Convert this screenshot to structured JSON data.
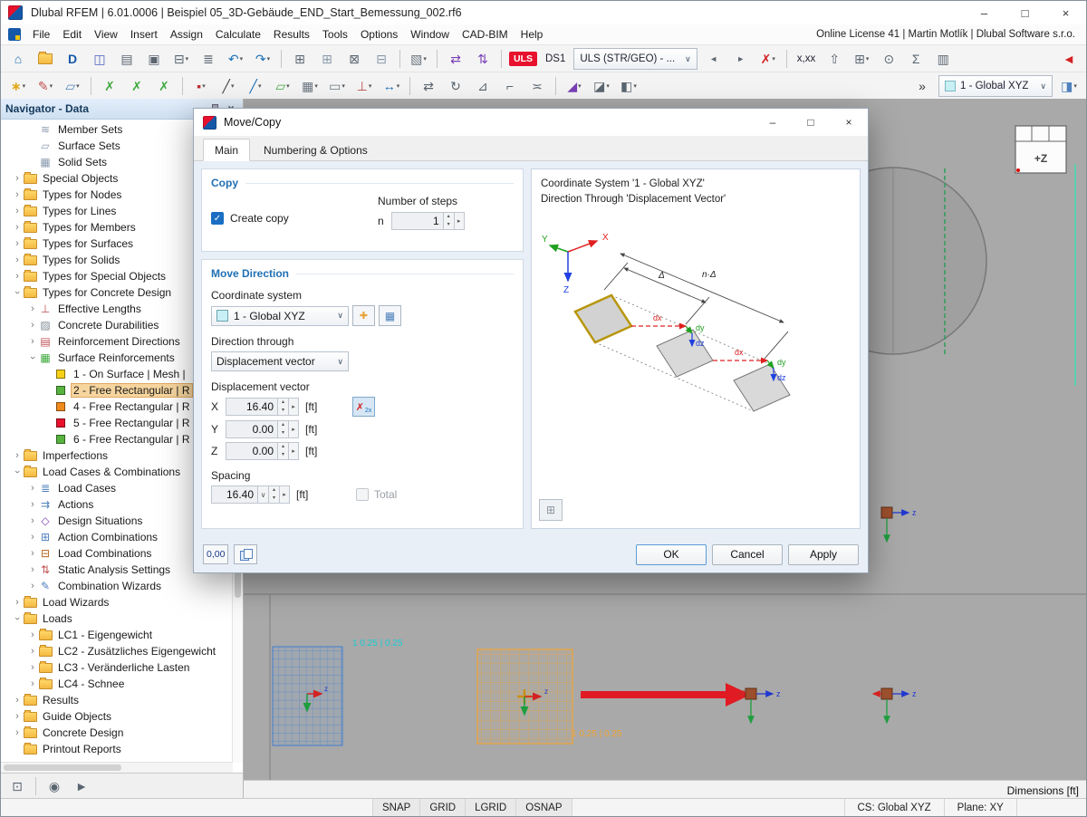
{
  "window": {
    "title": "Dlubal RFEM | 6.01.0006 | Beispiel 05_3D-Gebäude_END_Start_Bemessung_002.rf6",
    "minimize": "–",
    "maximize": "□",
    "close": "×"
  },
  "menu": {
    "items": [
      "File",
      "Edit",
      "View",
      "Insert",
      "Assign",
      "Calculate",
      "Results",
      "Tools",
      "Options",
      "Window",
      "CAD-BIM",
      "Help"
    ],
    "right_text": "Online License 41 | Martin Motlík | Dlubal Software s.r.o."
  },
  "toolbar_main": {
    "items": [
      {
        "name": "new-model-button",
        "glyph": "⌂",
        "color": "#1c6fb8"
      },
      {
        "name": "open-file-button",
        "folder": true
      },
      {
        "name": "dlubal-center-button",
        "glyph": "D",
        "color": "#1558a8",
        "bold": true
      },
      {
        "name": "bim-connect-button",
        "glyph": "◫",
        "color": "#4a5fc1"
      },
      {
        "name": "print-preview-button",
        "glyph": "▤",
        "color": "#5a6570"
      },
      {
        "name": "save-button",
        "glyph": "▣",
        "color": "#5a6570"
      },
      {
        "name": "print-button",
        "glyph": "⊟",
        "color": "#5a6570",
        "caret": true
      },
      {
        "name": "printout-report-button",
        "glyph": "≣",
        "color": "#5a6570"
      },
      {
        "name": "undo-button",
        "glyph": "↶",
        "color": "#1c6fb8",
        "caret": true
      },
      {
        "name": "redo-button",
        "glyph": "↷",
        "color": "#1c6fb8",
        "caret": true
      },
      {
        "sep": true
      },
      {
        "name": "new-table-button",
        "glyph": "⊞",
        "color": "#5a6570"
      },
      {
        "name": "tables-button",
        "glyph": "⊞",
        "color": "#8899aa"
      },
      {
        "name": "table-filter-button",
        "glyph": "⊠",
        "color": "#5a6570"
      },
      {
        "name": "table-relations-button",
        "glyph": "⊟",
        "color": "#8899aa"
      },
      {
        "sep": true
      },
      {
        "name": "rendering-button",
        "glyph": "▧",
        "color": "#6a7580",
        "caret": true
      },
      {
        "sep": true
      },
      {
        "name": "import-export-button",
        "glyph": "⇄",
        "color": "#7a3fb5"
      },
      {
        "name": "load-transfer-button",
        "glyph": "⇅",
        "color": "#7a3fb5"
      },
      {
        "sep": true
      },
      {
        "name": "uls-badge",
        "badge": "ULS",
        "bg": "#e8112d",
        "fg": "#ffffff"
      },
      {
        "name": "design-situation-label",
        "text": "DS1"
      },
      {
        "name": "design-situation-combo",
        "combo": "ULS (STR/GEO) - ..."
      },
      {
        "name": "previous-button",
        "glyph": "◄",
        "color": "#5a6570",
        "small": true
      },
      {
        "name": "next-button",
        "glyph": "►",
        "color": "#5a6570",
        "small": true
      },
      {
        "name": "delete-results-button",
        "glyph": "✗",
        "color": "#d42222",
        "caret": true
      },
      {
        "sep": true
      },
      {
        "name": "decimal-places-button",
        "text": "x,xx"
      },
      {
        "name": "user-view-button",
        "glyph": "⇧",
        "color": "#5a6570"
      },
      {
        "name": "result-tables-button",
        "glyph": "⊞",
        "color": "#5a6570",
        "caret": true
      },
      {
        "name": "search-button",
        "glyph": "⊙",
        "color": "#5a6570"
      },
      {
        "name": "sum-button",
        "glyph": "Σ",
        "color": "#5a6570"
      },
      {
        "name": "pages-button",
        "glyph": "▥",
        "color": "#5a6570"
      },
      {
        "name": "go-back-button",
        "glyph": "◄",
        "color": "#d42222",
        "bold": true,
        "gap": true
      }
    ]
  },
  "toolbar_edit": {
    "items": [
      {
        "name": "snap-settings-button",
        "glyph": "∗",
        "color": "#e0a818",
        "bold": true,
        "caret": true
      },
      {
        "name": "work-plane-button",
        "glyph": "✎",
        "color": "#c05050",
        "caret": true
      },
      {
        "name": "grid-settings-button",
        "glyph": "▱",
        "color": "#4f81bd",
        "caret": true
      },
      {
        "sep": true
      },
      {
        "name": "object-snap-toggle",
        "glyph": "✗",
        "color": "#3faa3f"
      },
      {
        "name": "grid-snap-toggle",
        "glyph": "✗",
        "color": "#3faa3f"
      },
      {
        "name": "guideline-snap-toggle",
        "glyph": "✗",
        "color": "#3faa3f"
      },
      {
        "sep": true
      },
      {
        "name": "insert-node-button",
        "glyph": "▪",
        "color": "#c03030",
        "caret": true
      },
      {
        "name": "insert-line-button",
        "glyph": "╱",
        "color": "#444444",
        "caret": true
      },
      {
        "name": "insert-member-button",
        "glyph": "╱",
        "color": "#1c6fb8",
        "caret": true
      },
      {
        "name": "insert-surface-button",
        "glyph": "▱",
        "color": "#3faa3f",
        "caret": true
      },
      {
        "name": "insert-solid-button",
        "glyph": "▦",
        "color": "#6a7580",
        "caret": true
      },
      {
        "name": "insert-opening-button",
        "glyph": "▭",
        "color": "#6a7580",
        "caret": true
      },
      {
        "name": "insert-support-button",
        "glyph": "⊥",
        "color": "#c05050",
        "caret": true
      },
      {
        "name": "insert-dimension-button",
        "glyph": "↔",
        "color": "#1c6fb8",
        "caret": true
      },
      {
        "sep": true
      },
      {
        "name": "move-copy-button",
        "glyph": "⇄",
        "color": "#5a6570"
      },
      {
        "name": "rotate-button",
        "glyph": "↻",
        "color": "#5a6570"
      },
      {
        "name": "mirror-button",
        "glyph": "⊿",
        "color": "#5a6570"
      },
      {
        "name": "trim-button",
        "glyph": "⌐",
        "color": "#5a6570"
      },
      {
        "name": "divide-button",
        "glyph": "≍",
        "color": "#5a6570"
      },
      {
        "sep": true
      },
      {
        "name": "section-button",
        "glyph": "◢",
        "color": "#7a3fb5",
        "caret": true
      },
      {
        "name": "visibility-button",
        "glyph": "◪",
        "color": "#5a6570",
        "caret": true
      },
      {
        "name": "clipping-button",
        "glyph": "◧",
        "color": "#5a6570",
        "caret": true
      },
      {
        "name": "overflow-button",
        "glyph": "»",
        "color": "#333333",
        "gap": true
      },
      {
        "name": "coordinate-system-combo",
        "combo": "1 - Global XYZ",
        "swatch": "#c8f0f4"
      },
      {
        "name": "background-layers-button",
        "glyph": "◨",
        "color": "#4f81bd",
        "caret": true
      }
    ]
  },
  "navigator": {
    "title": "Navigator - Data",
    "tree": [
      {
        "label": "Member Sets",
        "level": 2,
        "glyph": "≋",
        "color": "#8a9bb0"
      },
      {
        "label": "Surface Sets",
        "level": 2,
        "glyph": "▱",
        "color": "#8a9bb0"
      },
      {
        "label": "Solid Sets",
        "level": 2,
        "glyph": "▦",
        "color": "#8a9bb0"
      },
      {
        "label": "Special Objects",
        "level": 1,
        "arrow": true,
        "folder": true
      },
      {
        "label": "Types for Nodes",
        "level": 1,
        "arrow": true,
        "folder": true
      },
      {
        "label": "Types for Lines",
        "level": 1,
        "arrow": true,
        "folder": true
      },
      {
        "label": "Types for Members",
        "level": 1,
        "arrow": true,
        "folder": true
      },
      {
        "label": "Types for Surfaces",
        "level": 1,
        "arrow": true,
        "folder": true
      },
      {
        "label": "Types for Solids",
        "level": 1,
        "arrow": true,
        "folder": true
      },
      {
        "label": "Types for Special Objects",
        "level": 1,
        "arrow": true,
        "folder": true
      },
      {
        "label": "Types for Concrete Design",
        "level": 1,
        "arrow": true,
        "expanded": true,
        "folder": true
      },
      {
        "label": "Effective Lengths",
        "level": 2,
        "arrow": true,
        "glyph": "⊥",
        "color": "#c05050"
      },
      {
        "label": "Concrete Durabilities",
        "level": 2,
        "arrow": true,
        "glyph": "▨",
        "color": "#7f8b96"
      },
      {
        "label": "Reinforcement Directions",
        "level": 2,
        "arrow": true,
        "glyph": "▤",
        "color": "#c05050"
      },
      {
        "label": "Surface Reinforcements",
        "level": 2,
        "arrow": true,
        "expanded": true,
        "glyph": "▦",
        "color": "#3faa3f"
      },
      {
        "label": "1 - On Surface | Mesh |",
        "level": 3,
        "sq": "#f7d117"
      },
      {
        "label": "2 - Free Rectangular | R",
        "level": 3,
        "sq": "#57b33e",
        "selected": true
      },
      {
        "label": "4 - Free Rectangular | R",
        "level": 3,
        "sq": "#f08a1d"
      },
      {
        "label": "5 - Free Rectangular | R",
        "level": 3,
        "sq": "#e8112d"
      },
      {
        "label": "6 - Free Rectangular | R",
        "level": 3,
        "sq": "#57b33e"
      },
      {
        "label": "Imperfections",
        "level": 1,
        "arrow": true,
        "folder": true
      },
      {
        "label": "Load Cases & Combinations",
        "level": 1,
        "arrow": true,
        "expanded": true,
        "folder": true
      },
      {
        "label": "Load Cases",
        "level": 2,
        "arrow": true,
        "glyph": "≣",
        "color": "#4f81bd"
      },
      {
        "label": "Actions",
        "level": 2,
        "arrow": true,
        "glyph": "⇉",
        "color": "#4f81bd"
      },
      {
        "label": "Design Situations",
        "level": 2,
        "arrow": true,
        "glyph": "◇",
        "color": "#7a3fb5"
      },
      {
        "label": "Action Combinations",
        "level": 2,
        "arrow": true,
        "glyph": "⊞",
        "color": "#4f81bd"
      },
      {
        "label": "Load Combinations",
        "level": 2,
        "arrow": true,
        "glyph": "⊟",
        "color": "#b5651d"
      },
      {
        "label": "Static Analysis Settings",
        "level": 2,
        "arrow": true,
        "glyph": "⇅",
        "color": "#c05050"
      },
      {
        "label": "Combination Wizards",
        "level": 2,
        "arrow": true,
        "glyph": "✎",
        "color": "#4f81bd"
      },
      {
        "label": "Load Wizards",
        "level": 1,
        "arrow": true,
        "folder": true
      },
      {
        "label": "Loads",
        "level": 1,
        "arrow": true,
        "expanded": true,
        "folder": true
      },
      {
        "label": "LC1 - Eigengewicht",
        "level": 2,
        "arrow": true,
        "folder": true
      },
      {
        "label": "LC2 - Zusätzliches Eigengewicht",
        "level": 2,
        "arrow": true,
        "folder": true
      },
      {
        "label": "LC3 - Veränderliche Lasten",
        "level": 2,
        "arrow": true,
        "folder": true
      },
      {
        "label": "LC4 - Schnee",
        "level": 2,
        "arrow": true,
        "folder": true
      },
      {
        "label": "Results",
        "level": 1,
        "arrow": true,
        "folder": true
      },
      {
        "label": "Guide Objects",
        "level": 1,
        "arrow": true,
        "folder": true
      },
      {
        "label": "Concrete Design",
        "level": 1,
        "arrow": true,
        "folder": true
      },
      {
        "label": "Printout Reports",
        "level": 1,
        "folder": true
      }
    ],
    "bottom_items": [
      {
        "name": "navigator-display-button",
        "glyph": "⊡",
        "color": "#5a6570"
      },
      {
        "sep": true
      },
      {
        "name": "visibility-eye-button",
        "glyph": "◉",
        "color": "#5a6570"
      },
      {
        "name": "camera-button",
        "glyph": "►",
        "color": "#5a6570"
      }
    ]
  },
  "dialog": {
    "title": "Move/Copy",
    "tabs": [
      {
        "label": "Main",
        "active": true
      },
      {
        "label": "Numbering & Options"
      }
    ],
    "copy": {
      "header": "Copy",
      "create_copy": "Create copy",
      "checked": true,
      "steps_label": "Number of steps",
      "n": "n",
      "n_value": "1"
    },
    "move": {
      "header": "Move Direction",
      "cs_label": "Coordinate system",
      "cs_value": "1 - Global XYZ",
      "dir_label": "Direction through",
      "dir_value": "Displacement vector",
      "vec_label": "Displacement vector",
      "axes": [
        {
          "axis": "X",
          "value": "16.40",
          "unit": "[ft]",
          "picker": true
        },
        {
          "axis": "Y",
          "value": "0.00",
          "unit": "[ft]"
        },
        {
          "axis": "Z",
          "value": "0.00",
          "unit": "[ft]"
        }
      ],
      "spacing_label": "Spacing",
      "spacing_value": "16.40",
      "spacing_unit": "[ft]",
      "total_label": "Total"
    },
    "preview": {
      "line1": "Coordinate System '1 - Global XYZ'",
      "line2": "Direction Through 'Displacement Vector'",
      "labels": {
        "x": "X",
        "y": "Y",
        "z": "Z",
        "dx": "dx",
        "dy": "dy",
        "dz": "dz",
        "delta": "Δ",
        "ndelta": "n·Δ"
      }
    },
    "footer": {
      "decimals": "0,00",
      "ok": "OK",
      "cancel": "Cancel",
      "apply": "Apply"
    }
  },
  "canvas": {
    "viewcube": "+Z",
    "axis_z": "z",
    "grid_note_cyan": "1 0.25 | 0.25",
    "grid_note_orange": "1 0.25 | 0.25"
  },
  "statusbar": {
    "toggles": [
      "SNAP",
      "GRID",
      "LGRID",
      "OSNAP"
    ],
    "cs": "CS: Global XYZ",
    "plane": "Plane: XY",
    "dimensions": "Dimensions [ft]"
  }
}
